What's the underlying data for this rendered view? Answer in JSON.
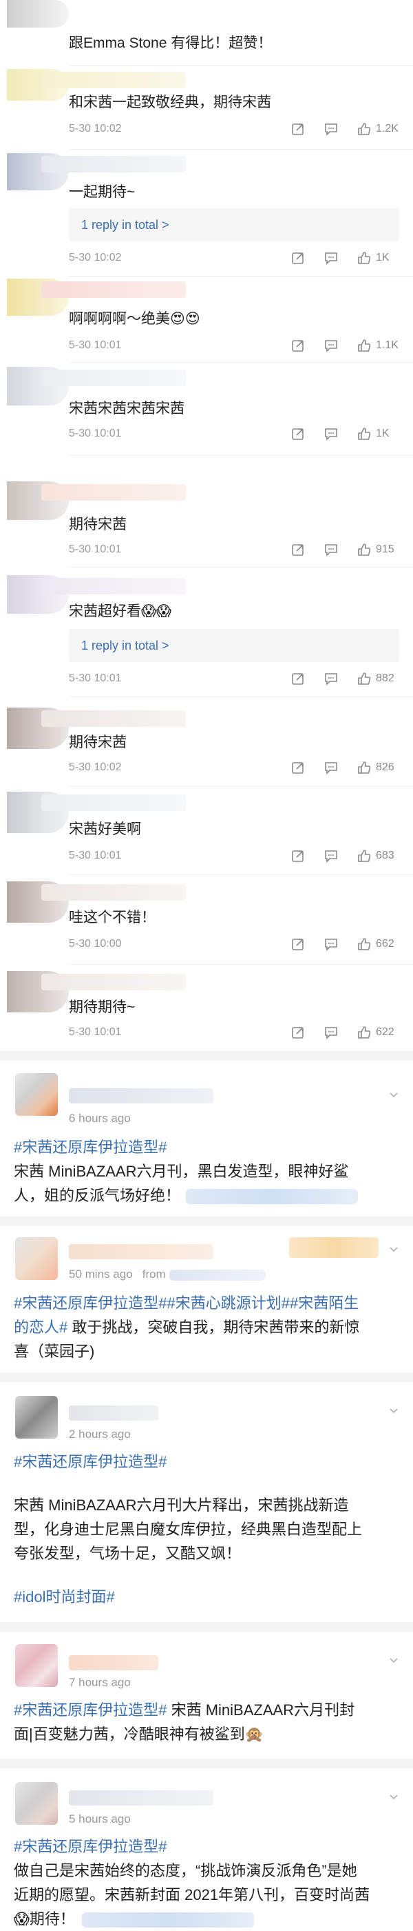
{
  "comments": [
    {
      "text": "跟Emma Stone 有得比！超赞！",
      "time": "",
      "likes": ""
    },
    {
      "text": "和宋茜一起致敬经典，期待宋茜",
      "time": "5-30 10:02",
      "likes": "1.2K"
    },
    {
      "text": "一起期待~",
      "time": "5-30 10:02",
      "likes": "1K",
      "reply": "1 reply in total >"
    },
    {
      "text": "啊啊啊啊～绝美😍😍",
      "time": "5-30 10:01",
      "likes": "1.1K"
    },
    {
      "text": "宋茜宋茜宋茜宋茜",
      "time": "5-30 10:01",
      "likes": "1K"
    },
    {
      "text": "期待宋茜",
      "time": "5-30 10:01",
      "likes": "915"
    },
    {
      "text": "宋茜超好看😱😱",
      "time": "5-30 10:01",
      "likes": "882",
      "reply": "1 reply in total >"
    },
    {
      "text": "期待宋茜",
      "time": "5-30 10:02",
      "likes": "826"
    },
    {
      "text": "宋茜好美啊",
      "time": "5-30 10:01",
      "likes": "683"
    },
    {
      "text": "哇这个不错！",
      "time": "5-30 10:00",
      "likes": "662"
    },
    {
      "text": "期待期待~",
      "time": "5-30 10:01",
      "likes": "622"
    }
  ],
  "posts": [
    {
      "meta": "6 hours ago",
      "tag1": "#宋茜还原库伊拉造型#",
      "body1": "宋茜 MiniBAZAAR六月刊，黑白发造型，眼神好鲨",
      "body2": "人，姐的反派气场好绝！"
    },
    {
      "meta": "50 mins ago",
      "meta_from": "from",
      "line1_tag1": "#宋茜还原库伊拉造型#",
      "line1_tag2": "#宋茜心跳源计划#",
      "line1_tag3": "#宋茜陌生",
      "line2_tag": "的恋人#",
      "line2_text": " 敢于挑战，突破自我，期待宋茜带来的新惊",
      "line3_text": "喜（菜园子)"
    },
    {
      "meta": "2 hours ago",
      "tag1": "#宋茜还原库伊拉造型#",
      "para1": "宋茜 MiniBAZAAR六月刊大片释出，宋茜挑战新造",
      "para2": "型，化身迪士尼黑白魔女库伊拉，经典黑白造型配上",
      "para3": "夸张发型，气场十足，又酷又飒！",
      "tag2": "#idol时尚封面#"
    },
    {
      "meta": "7 hours ago",
      "tag1": "#宋茜还原库伊拉造型#",
      "line1_text": " 宋茜 MiniBAZAAR六月刊封",
      "line2_text": "面|百变魅力茜，冷酷眼神有被鲨到🙊"
    },
    {
      "meta": "5 hours ago",
      "tag1": "#宋茜还原库伊拉造型#",
      "line1": "做自己是宋茜始终的态度，“挑战饰演反派角色”是她",
      "line2": "近期的愿望。宋茜新封面 2021年第八刊，百变时尚茜",
      "line3": "😱期待！"
    }
  ],
  "colors": {
    "link": "#3a6fb0",
    "meta": "#9a9a9a",
    "separator": "#f3f3f3"
  }
}
